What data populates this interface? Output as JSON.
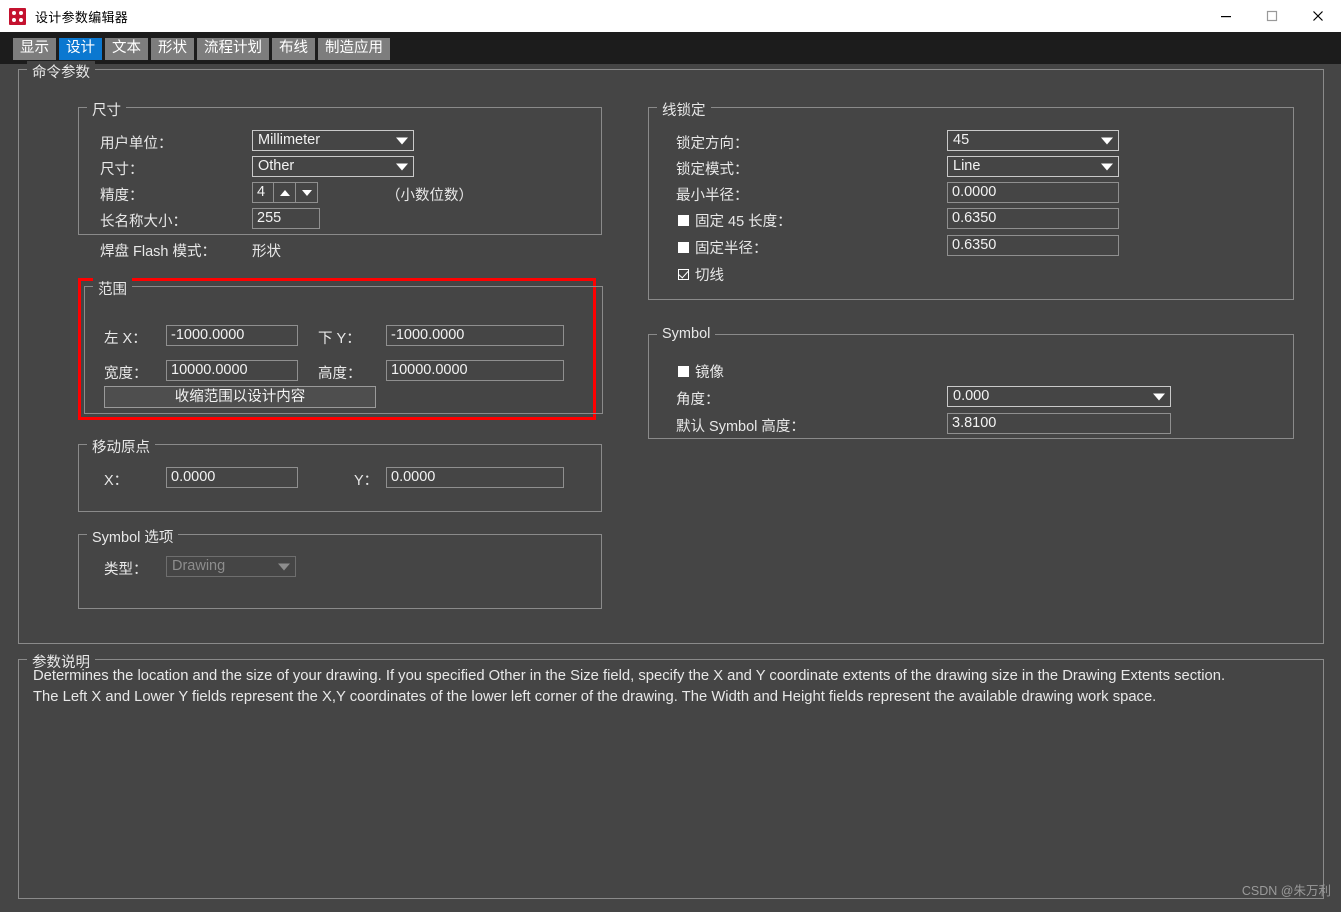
{
  "window": {
    "title": "设计参数编辑器",
    "icon": "app-dice-icon",
    "controls": {
      "minimize": "minimize-icon",
      "maximize": "maximize-icon",
      "close": "close-icon"
    }
  },
  "tabs": [
    {
      "label": "显示",
      "active": false
    },
    {
      "label": "设计",
      "active": true
    },
    {
      "label": "文本",
      "active": false
    },
    {
      "label": "形状",
      "active": false
    },
    {
      "label": "流程计划",
      "active": false
    },
    {
      "label": "布线",
      "active": false
    },
    {
      "label": "制造应用",
      "active": false
    }
  ],
  "command_params": {
    "legend": "命令参数"
  },
  "size_group": {
    "legend": "尺寸",
    "user_unit_label": "用户单位：",
    "user_unit_value": "Millimeter",
    "size_label": "尺寸：",
    "size_value": "Other",
    "accuracy_label": "精度：",
    "accuracy_value": "4",
    "accuracy_hint": "（小数位数）",
    "long_name_label": "长名称大小：",
    "long_name_value": "255",
    "pad_flash_label": "焊盘 Flash 模式：",
    "pad_flash_value": "形状"
  },
  "range_group": {
    "legend": "范围",
    "left_x_label": "左 X：",
    "left_x_value": "-1000.0000",
    "lower_y_label": "下 Y：",
    "lower_y_value": "-1000.0000",
    "width_label": "宽度：",
    "width_value": "10000.0000",
    "height_label": "高度：",
    "height_value": "10000.0000",
    "shrink_button": "收缩范围以设计内容",
    "highlight_color": "#ff0000"
  },
  "move_origin_group": {
    "legend": "移动原点",
    "x_label": "X：",
    "x_value": "0.0000",
    "y_label": "Y：",
    "y_value": "0.0000"
  },
  "symbol_options_group": {
    "legend": "Symbol 选项",
    "type_label": "类型：",
    "type_value": "Drawing"
  },
  "line_lock_group": {
    "legend": "线锁定",
    "lock_direction_label": "锁定方向：",
    "lock_direction_value": "45",
    "lock_mode_label": "锁定模式：",
    "lock_mode_value": "Line",
    "min_radius_label": "最小半径：",
    "min_radius_value": "0.0000",
    "fixed_45_label": "固定 45 长度：",
    "fixed_45_value": "0.6350",
    "fixed_45_checked": false,
    "fixed_radius_label": "固定半径：",
    "fixed_radius_value": "0.6350",
    "fixed_radius_checked": false,
    "tangent_label": "切线",
    "tangent_checked": true
  },
  "symbol_group": {
    "legend": "Symbol",
    "mirror_label": "镜像",
    "mirror_checked": false,
    "angle_label": "角度：",
    "angle_value": "0.000",
    "default_height_label": "默认 Symbol 高度：",
    "default_height_value": "3.8100"
  },
  "description_group": {
    "legend": "参数说明",
    "line1": "Determines the location and the size of your drawing. If you specified Other in the Size field, specify the X and Y coordinate extents of the drawing size in the Drawing Extents section.",
    "line2": "The Left X and Lower Y fields represent the X,Y coordinates of the lower left corner of the drawing. The Width and Height fields represent the available drawing work space."
  },
  "watermark": "CSDN @朱万利",
  "theme": {
    "background": "#454545",
    "accent": "#0b78d0",
    "text": "#e8e8e8",
    "border": "#8a8a8a",
    "titlebar": "#ffffff",
    "tabstrip": "#1c1c1c"
  }
}
